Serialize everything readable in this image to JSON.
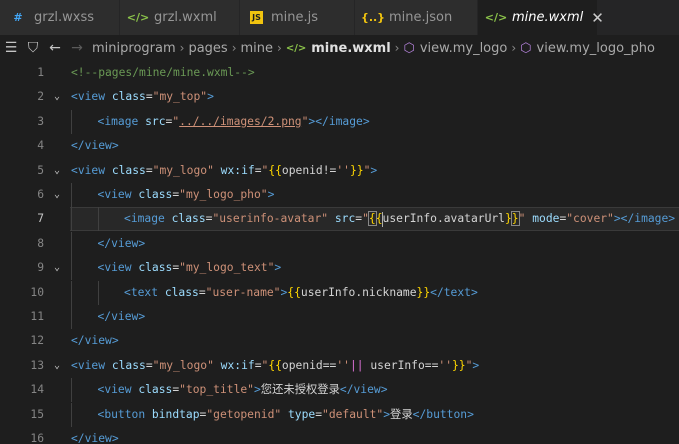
{
  "tabs": [
    {
      "label": "grzl.wxss",
      "icon": "css-file-icon",
      "glyph": "#",
      "color": "#42a5f5",
      "active": false
    },
    {
      "label": "grzl.wxml",
      "icon": "wxml-file-icon",
      "glyph": "</>",
      "color": "#8bc34a",
      "active": false
    },
    {
      "label": "mine.js",
      "icon": "js-file-icon",
      "glyph": "JS",
      "color": "#f1c40f",
      "active": false
    },
    {
      "label": "mine.json",
      "icon": "json-file-icon",
      "glyph": "{..}",
      "color": "#f1c40f",
      "active": false
    },
    {
      "label": "mine.wxml",
      "icon": "wxml-file-icon",
      "glyph": "</>",
      "color": "#8bc34a",
      "active": true
    }
  ],
  "breadcrumb": {
    "items": [
      "miniprogram",
      "pages",
      "mine",
      "mine.wxml",
      "view.my_logo",
      "view.my_logo_pho"
    ]
  },
  "editor": {
    "current_line": 7,
    "lines": [
      {
        "n": "1",
        "indent": 0,
        "fold": false,
        "tokens": [
          [
            "c",
            "<!--pages/mine/mine.wxml-->"
          ]
        ]
      },
      {
        "n": "2",
        "indent": 0,
        "fold": true,
        "tokens": [
          [
            "g",
            "<"
          ],
          [
            "t",
            "view"
          ],
          [
            "a",
            " class"
          ],
          [
            "x",
            "="
          ],
          [
            "s",
            "\"my_top\""
          ],
          [
            "g",
            ">"
          ]
        ]
      },
      {
        "n": "3",
        "indent": 1,
        "fold": false,
        "tokens": [
          [
            "g",
            "<"
          ],
          [
            "t",
            "image"
          ],
          [
            "a",
            " src"
          ],
          [
            "x",
            "="
          ],
          [
            "s",
            "\""
          ],
          [
            "su",
            "../../images/2.png"
          ],
          [
            "s",
            "\""
          ],
          [
            "g",
            "></"
          ],
          [
            "t",
            "image"
          ],
          [
            "g",
            ">"
          ]
        ]
      },
      {
        "n": "4",
        "indent": 0,
        "fold": false,
        "tokens": [
          [
            "g",
            "</"
          ],
          [
            "t",
            "view"
          ],
          [
            "g",
            ">"
          ]
        ]
      },
      {
        "n": "5",
        "indent": 0,
        "fold": true,
        "tokens": [
          [
            "g",
            "<"
          ],
          [
            "t",
            "view"
          ],
          [
            "a",
            " class"
          ],
          [
            "x",
            "="
          ],
          [
            "s",
            "\"my_logo\""
          ],
          [
            "a",
            " wx:if"
          ],
          [
            "x",
            "="
          ],
          [
            "s",
            "\""
          ],
          [
            "b",
            "{{"
          ],
          [
            "e",
            "openid!="
          ],
          [
            "s",
            "''"
          ],
          [
            "b",
            "}}"
          ],
          [
            "s",
            "\""
          ],
          [
            "g",
            ">"
          ]
        ]
      },
      {
        "n": "6",
        "indent": 1,
        "fold": true,
        "tokens": [
          [
            "g",
            "<"
          ],
          [
            "t",
            "view"
          ],
          [
            "a",
            " class"
          ],
          [
            "x",
            "="
          ],
          [
            "s",
            "\"my_logo_pho\""
          ],
          [
            "g",
            ">"
          ]
        ]
      },
      {
        "n": "7",
        "indent": 2,
        "fold": false,
        "tokens": [
          [
            "g",
            "<"
          ],
          [
            "t",
            "image"
          ],
          [
            "a",
            " class"
          ],
          [
            "x",
            "="
          ],
          [
            "s",
            "\"userinfo-avatar\""
          ],
          [
            "a",
            " src"
          ],
          [
            "x",
            "="
          ],
          [
            "s",
            "\""
          ],
          [
            "bm",
            "{"
          ],
          [
            "b",
            "{"
          ],
          [
            "cur",
            ""
          ],
          [
            "e",
            "userInfo.avatarUrl"
          ],
          [
            "b",
            "}"
          ],
          [
            "bm",
            "}"
          ],
          [
            "s",
            "\""
          ],
          [
            "a",
            " mode"
          ],
          [
            "x",
            "="
          ],
          [
            "s",
            "\"cover\""
          ],
          [
            "g",
            "></"
          ],
          [
            "t",
            "image"
          ],
          [
            "g",
            ">"
          ]
        ]
      },
      {
        "n": "8",
        "indent": 1,
        "fold": false,
        "tokens": [
          [
            "g",
            "</"
          ],
          [
            "t",
            "view"
          ],
          [
            "g",
            ">"
          ]
        ]
      },
      {
        "n": "9",
        "indent": 1,
        "fold": true,
        "tokens": [
          [
            "g",
            "<"
          ],
          [
            "t",
            "view"
          ],
          [
            "a",
            " class"
          ],
          [
            "x",
            "="
          ],
          [
            "s",
            "\"my_logo_text\""
          ],
          [
            "g",
            ">"
          ]
        ]
      },
      {
        "n": "10",
        "indent": 2,
        "fold": false,
        "tokens": [
          [
            "g",
            "<"
          ],
          [
            "t",
            "text"
          ],
          [
            "a",
            " class"
          ],
          [
            "x",
            "="
          ],
          [
            "s",
            "\"user-name\""
          ],
          [
            "g",
            ">"
          ],
          [
            "b",
            "{{"
          ],
          [
            "e",
            "userInfo.nickname"
          ],
          [
            "b",
            "}}"
          ],
          [
            "g",
            "</"
          ],
          [
            "t",
            "text"
          ],
          [
            "g",
            ">"
          ]
        ]
      },
      {
        "n": "11",
        "indent": 1,
        "fold": false,
        "tokens": [
          [
            "g",
            "</"
          ],
          [
            "t",
            "view"
          ],
          [
            "g",
            ">"
          ]
        ]
      },
      {
        "n": "12",
        "indent": 0,
        "fold": false,
        "tokens": [
          [
            "g",
            "</"
          ],
          [
            "t",
            "view"
          ],
          [
            "g",
            ">"
          ]
        ]
      },
      {
        "n": "13",
        "indent": 0,
        "fold": true,
        "tokens": [
          [
            "g",
            "<"
          ],
          [
            "t",
            "view"
          ],
          [
            "a",
            " class"
          ],
          [
            "x",
            "="
          ],
          [
            "s",
            "\"my_logo\""
          ],
          [
            "a",
            " wx:if"
          ],
          [
            "x",
            "="
          ],
          [
            "s",
            "\""
          ],
          [
            "b",
            "{{"
          ],
          [
            "e",
            "openid=="
          ],
          [
            "s",
            "''"
          ],
          [
            "p",
            "||"
          ],
          [
            "e",
            " userInfo=="
          ],
          [
            "s",
            "''"
          ],
          [
            "b",
            "}}"
          ],
          [
            "s",
            "\""
          ],
          [
            "g",
            ">"
          ]
        ]
      },
      {
        "n": "14",
        "indent": 1,
        "fold": false,
        "tokens": [
          [
            "g",
            "<"
          ],
          [
            "t",
            "view"
          ],
          [
            "a",
            " class"
          ],
          [
            "x",
            "="
          ],
          [
            "s",
            "\"top_title\""
          ],
          [
            "g",
            ">"
          ],
          [
            "x",
            "您还未授权登录"
          ],
          [
            "g",
            "</"
          ],
          [
            "t",
            "view"
          ],
          [
            "g",
            ">"
          ]
        ]
      },
      {
        "n": "15",
        "indent": 1,
        "fold": false,
        "tokens": [
          [
            "g",
            "<"
          ],
          [
            "t",
            "button"
          ],
          [
            "a",
            " bindtap"
          ],
          [
            "x",
            "="
          ],
          [
            "s",
            "\"getopenid\""
          ],
          [
            "a",
            " type"
          ],
          [
            "x",
            "="
          ],
          [
            "s",
            "\"default\""
          ],
          [
            "g",
            ">"
          ],
          [
            "x",
            "登录"
          ],
          [
            "g",
            "</"
          ],
          [
            "t",
            "button"
          ],
          [
            "g",
            ">"
          ]
        ]
      },
      {
        "n": "16",
        "indent": 0,
        "fold": false,
        "tokens": [
          [
            "g",
            "</"
          ],
          [
            "t",
            "view"
          ],
          [
            "g",
            ">"
          ]
        ]
      }
    ]
  }
}
